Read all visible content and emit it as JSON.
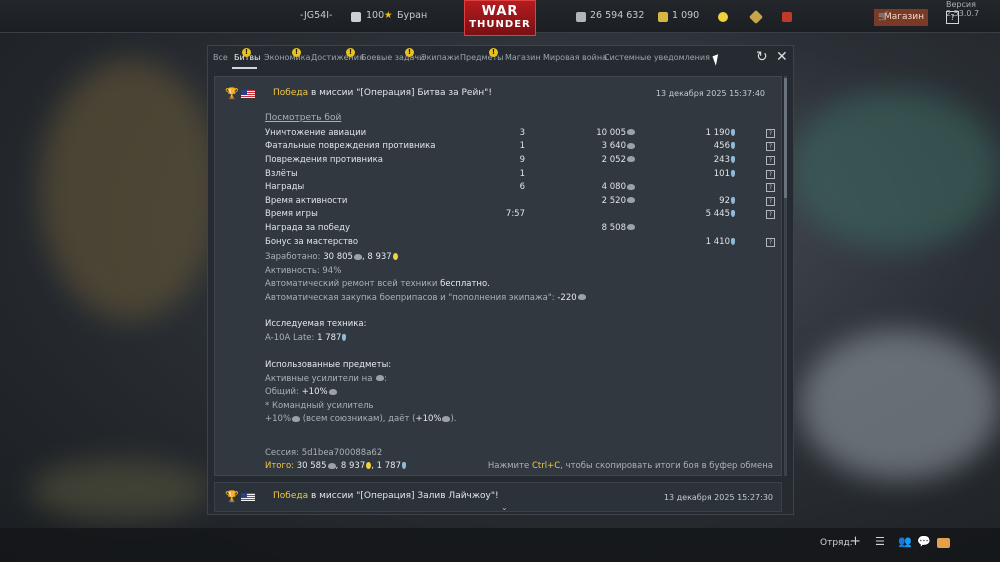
{
  "topbar": {
    "clan_tag": "-JG54I-",
    "rank_badge": "100",
    "player_name": "Буран",
    "silver_lions": "26 594 632",
    "golden_eagles": "1 090",
    "shop_label": "Магазин",
    "help_label": "?",
    "version": "Версия 2.53.0.7",
    "logo_top": "WAR",
    "logo_bottom": "THUNDER"
  },
  "tabs": [
    {
      "label": "Все",
      "warn": false
    },
    {
      "label": "Битвы",
      "warn": true,
      "active": true
    },
    {
      "label": "Экономика",
      "warn": true
    },
    {
      "label": "Достижения",
      "warn": true
    },
    {
      "label": "Боевые задачи",
      "warn": true
    },
    {
      "label": "Экипажи",
      "warn": false
    },
    {
      "label": "Предметы",
      "warn": true
    },
    {
      "label": "Магазин",
      "warn": false
    },
    {
      "label": "Мировая война",
      "warn": false
    },
    {
      "label": "Системные уведомления",
      "warn": false
    }
  ],
  "battle1": {
    "result_word": "Победа",
    "mission_text": " в миссии \"[Операция] Битва за Рейн\"!",
    "date": "13 декабря 2025 15:37:40",
    "view_link": "Посмотреть бой",
    "rows": [
      {
        "name": "Уничтожение авиации",
        "count": "3",
        "sl": "10 005",
        "rp": "1 190",
        "help": "?"
      },
      {
        "name": "Фатальные повреждения противника",
        "count": "1",
        "sl": "3 640",
        "rp": "456",
        "help": "?"
      },
      {
        "name": "Повреждения противника",
        "count": "9",
        "sl": "2 052",
        "rp": "243",
        "help": "?"
      },
      {
        "name": "Взлёты",
        "count": "1",
        "sl": "",
        "rp": "101",
        "help": "?"
      },
      {
        "name": "Награды",
        "count": "6",
        "sl": "4 080",
        "rp": "",
        "help": "?"
      },
      {
        "name": "Время активности",
        "count": "",
        "sl": "2 520",
        "rp": "92",
        "help": "?"
      },
      {
        "name": "Время игры",
        "count": "7:57",
        "sl": "",
        "rp": "5 445",
        "help": "?"
      },
      {
        "name": "Награда за победу",
        "count": "",
        "sl": "8 508",
        "rp": "",
        "help": ""
      },
      {
        "name": "Бонус за мастерство",
        "count": "",
        "sl": "",
        "rp": "1 410",
        "help": "?"
      }
    ],
    "earned_label": "Заработано: ",
    "earned_sl": "30 805",
    "earned_rp": "8 937",
    "activity": "Активность: 94%",
    "repair_prefix": "Автоматический ремонт всей техники ",
    "repair_value": "бесплатно.",
    "ammo_prefix": "Автоматическая закупка боеприпасов и \"пополнения экипажа\": ",
    "ammo_value": "-220",
    "research_title": "Исследуемая техника:",
    "research_name": "A-10A Late: ",
    "research_value": "1 787",
    "items_title": "Использованные предметы:",
    "boosters_line": "Активные усилители на ",
    "general_prefix": "Общий: ",
    "general_value": "+10%",
    "commander_line": "* Командный усилитель",
    "commander_prefix": "+10%",
    "commander_mid": " (всем союзникам), даёт (",
    "commander_value": "+10%",
    "commander_end": ").",
    "session": "Сессия: 5d1bea700088a62",
    "total_label": "Итого: ",
    "total_sl": "30 585",
    "total_rp": "8 937",
    "total_gold_value": "1 787",
    "copy_prefix": "Нажмите ",
    "copy_key": "Ctrl+C",
    "copy_suffix": ", чтобы скопировать итоги боя в буфер обмена"
  },
  "battle2": {
    "result_word": "Победа",
    "mission_text": " в миссии \"[Операция] Залив Лайчжоу\"!",
    "date": "13 декабря 2025 15:27:30"
  },
  "bottombar": {
    "squad_label": "Отряд:"
  }
}
